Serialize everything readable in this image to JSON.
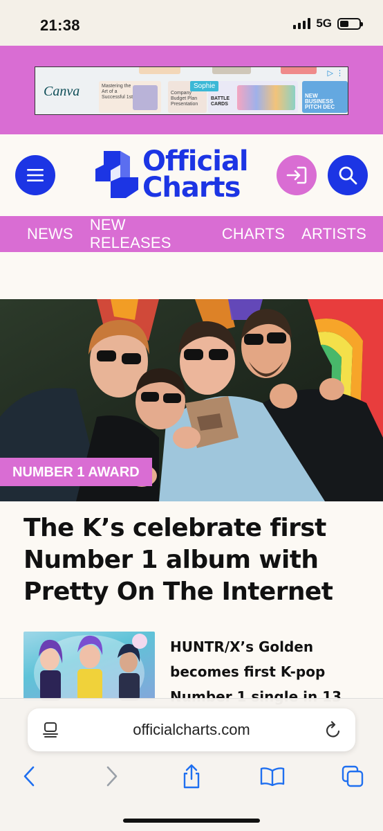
{
  "status_bar": {
    "time": "21:38",
    "network": "5G",
    "battery_level": 0.48
  },
  "ad": {
    "brand": "Canva",
    "card1_text": "Mastering the Art of a Successful 1st",
    "card2_text": "Company Budget Plan Presentation",
    "tag": "Sophie",
    "card3_text": "BATTLE CARDS",
    "card4_text": "NEW BUSINESS PITCH DEC"
  },
  "header": {
    "logo_line1": "Official",
    "logo_line2": "Charts"
  },
  "nav": {
    "items": [
      "NEWS",
      "NEW RELEASES",
      "CHARTS",
      "ARTISTS"
    ]
  },
  "hero": {
    "badge": "NUMBER 1 AWARD",
    "headline": "The K’s celebrate first Number 1 album with Pretty On The Internet"
  },
  "story": {
    "title": "HUNTR/X’s Golden becomes first K-pop Number 1 single in 13"
  },
  "browser": {
    "url": "officialcharts.com"
  },
  "colors": {
    "brand_blue": "#1c35e4",
    "brand_pink": "#d96dd3",
    "background": "#fcf9f4"
  },
  "icons": [
    "menu-icon",
    "login-icon",
    "search-icon",
    "page-menu-icon",
    "reload-icon",
    "back-icon",
    "forward-icon",
    "share-icon",
    "bookmarks-icon",
    "tabs-icon"
  ]
}
